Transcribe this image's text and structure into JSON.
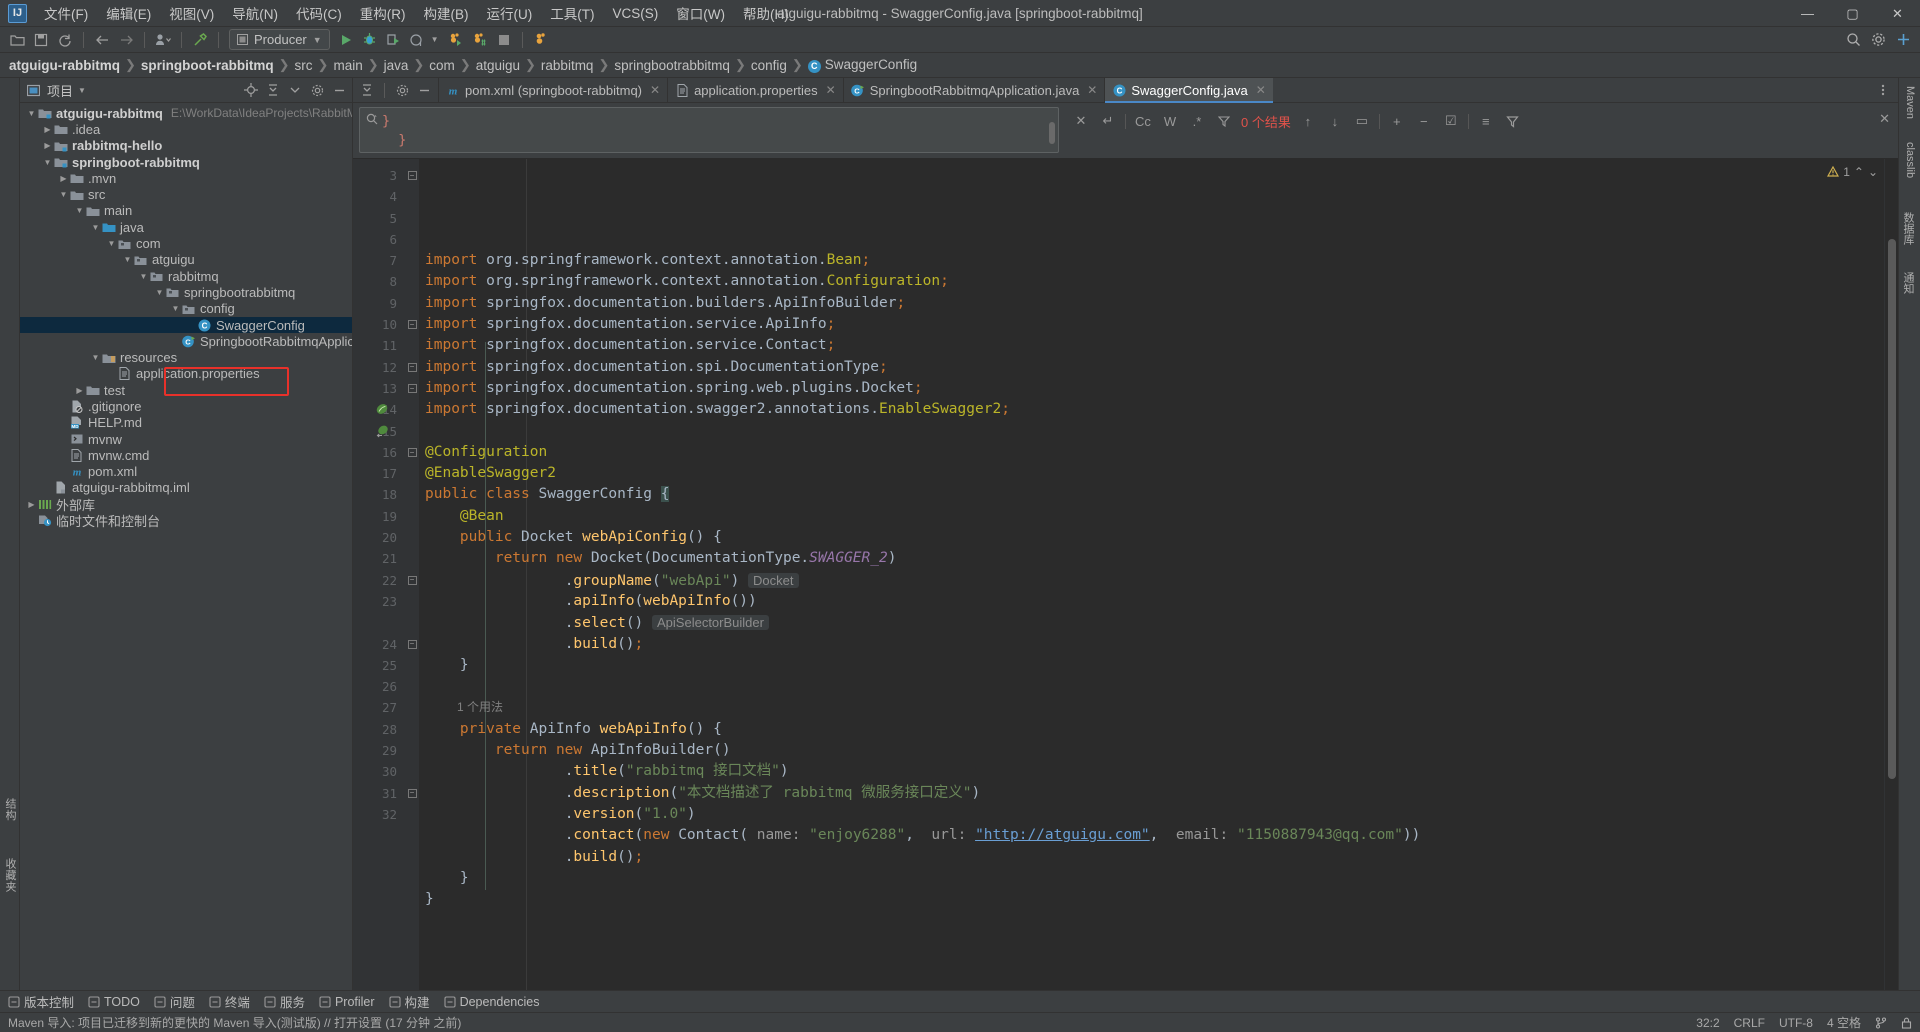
{
  "window": {
    "title": "atguigu-rabbitmq - SwaggerConfig.java [springboot-rabbitmq]",
    "logo": "IJ",
    "controls": {
      "minimize": "—",
      "maximize": "▢",
      "close": "✕"
    }
  },
  "menubar": [
    {
      "label": "文件(F)"
    },
    {
      "label": "编辑(E)"
    },
    {
      "label": "视图(V)"
    },
    {
      "label": "导航(N)"
    },
    {
      "label": "代码(C)"
    },
    {
      "label": "重构(R)"
    },
    {
      "label": "构建(B)"
    },
    {
      "label": "运行(U)"
    },
    {
      "label": "工具(T)"
    },
    {
      "label": "VCS(S)"
    },
    {
      "label": "窗口(W)"
    },
    {
      "label": "帮助(H)"
    }
  ],
  "toolbar": {
    "run_config": "Producer",
    "icons": [
      "open-folder-icon",
      "save-all-icon",
      "sync-icon",
      "back-icon",
      "forward-icon",
      "profile-icon",
      "build-icon",
      "run-icon",
      "debug-icon",
      "run-coverage-icon",
      "profiler-icon",
      "stop-icon"
    ],
    "right_icons": [
      "search-everywhere-icon",
      "settings-icon",
      "help-icon"
    ]
  },
  "breadcrumb": {
    "items": [
      {
        "label": "atguigu-rabbitmq",
        "bold": true
      },
      {
        "label": "springboot-rabbitmq",
        "bold": true
      },
      {
        "label": "src",
        "bold": false
      },
      {
        "label": "main",
        "bold": false
      },
      {
        "label": "java",
        "bold": false
      },
      {
        "label": "com",
        "bold": false
      },
      {
        "label": "atguigu",
        "bold": false
      },
      {
        "label": "rabbitmq",
        "bold": false
      },
      {
        "label": "springbootrabbitmq",
        "bold": false
      },
      {
        "label": "config",
        "bold": false
      },
      {
        "label": "SwaggerConfig",
        "bold": false,
        "icon": "class-icon"
      }
    ],
    "separator": "❯"
  },
  "project_panel": {
    "title": "项目",
    "title_icon": "project-icon",
    "header_icons": [
      "locate-icon",
      "collapse-all-icon",
      "options-icon",
      "settings-icon",
      "hide-icon"
    ],
    "tree": [
      {
        "depth": 0,
        "arrow": "down",
        "icon": "module-icon",
        "label": "atguigu-rabbitmq",
        "bold": true,
        "path": "E:\\WorkData\\IdeaProjects\\RabbitMQ\\at"
      },
      {
        "depth": 1,
        "arrow": "right",
        "icon": "folder-icon",
        "label": ".idea",
        "bold": false
      },
      {
        "depth": 1,
        "arrow": "right",
        "icon": "module-icon",
        "label": "rabbitmq-hello",
        "bold": true
      },
      {
        "depth": 1,
        "arrow": "down",
        "icon": "module-icon",
        "label": "springboot-rabbitmq",
        "bold": true
      },
      {
        "depth": 2,
        "arrow": "right",
        "icon": "folder-icon",
        "label": ".mvn",
        "bold": false
      },
      {
        "depth": 2,
        "arrow": "down",
        "icon": "folder-icon",
        "label": "src",
        "bold": false
      },
      {
        "depth": 3,
        "arrow": "down",
        "icon": "folder-icon",
        "label": "main",
        "bold": false
      },
      {
        "depth": 4,
        "arrow": "down",
        "icon": "source-folder-icon",
        "label": "java",
        "bold": false
      },
      {
        "depth": 5,
        "arrow": "down",
        "icon": "package-icon",
        "label": "com",
        "bold": false
      },
      {
        "depth": 6,
        "arrow": "down",
        "icon": "package-icon",
        "label": "atguigu",
        "bold": false
      },
      {
        "depth": 7,
        "arrow": "down",
        "icon": "package-icon",
        "label": "rabbitmq",
        "bold": false
      },
      {
        "depth": 8,
        "arrow": "down",
        "icon": "package-icon",
        "label": "springbootrabbitmq",
        "bold": false
      },
      {
        "depth": 9,
        "arrow": "down",
        "icon": "package-icon",
        "label": "config",
        "bold": false
      },
      {
        "depth": 10,
        "arrow": "none",
        "icon": "class-icon",
        "label": "SwaggerConfig",
        "bold": false,
        "selected": true
      },
      {
        "depth": 9,
        "arrow": "none",
        "icon": "spring-class-icon",
        "label": "SpringbootRabbitmqApplication",
        "bold": false
      },
      {
        "depth": 4,
        "arrow": "down",
        "icon": "resource-folder-icon",
        "label": "resources",
        "bold": false
      },
      {
        "depth": 5,
        "arrow": "none",
        "icon": "properties-icon",
        "label": "application.properties",
        "bold": false
      },
      {
        "depth": 3,
        "arrow": "right",
        "icon": "folder-icon",
        "label": "test",
        "bold": false
      },
      {
        "depth": 2,
        "arrow": "none",
        "icon": "gitignore-icon",
        "label": ".gitignore",
        "bold": false
      },
      {
        "depth": 2,
        "arrow": "none",
        "icon": "markdown-icon",
        "label": "HELP.md",
        "bold": false
      },
      {
        "depth": 2,
        "arrow": "none",
        "icon": "shell-icon",
        "label": "mvnw",
        "bold": false
      },
      {
        "depth": 2,
        "arrow": "none",
        "icon": "cmd-icon",
        "label": "mvnw.cmd",
        "bold": false
      },
      {
        "depth": 2,
        "arrow": "none",
        "icon": "maven-icon",
        "label": "pom.xml",
        "bold": false
      },
      {
        "depth": 1,
        "arrow": "none",
        "icon": "iml-icon",
        "label": "atguigu-rabbitmq.iml",
        "bold": false
      },
      {
        "depth": 0,
        "arrow": "right",
        "icon": "library-icon",
        "label": "外部库",
        "bold": false
      },
      {
        "depth": 0,
        "arrow": "none",
        "icon": "scratches-icon",
        "label": "临时文件和控制台",
        "bold": false
      }
    ]
  },
  "editor_tabs": {
    "tool_icons": [
      "collapse-icon",
      "settings-icon",
      "minimize-icon"
    ],
    "tabs": [
      {
        "label": "pom.xml (springboot-rabbitmq)",
        "icon": "maven-icon",
        "active": false,
        "close": "✕"
      },
      {
        "label": "application.properties",
        "icon": "properties-icon",
        "active": false,
        "close": "✕"
      },
      {
        "label": "SpringbootRabbitmqApplication.java",
        "icon": "spring-class-icon",
        "active": false,
        "close": "✕"
      },
      {
        "label": "SwaggerConfig.java",
        "icon": "class-icon",
        "active": true,
        "close": "✕"
      }
    ]
  },
  "find_bar": {
    "search_icon": "search-icon",
    "query_line1": "}",
    "query_line2": "}",
    "close_x": "✕",
    "regex_reset": "↵",
    "match_case": "Cc",
    "words": "W",
    "regex": ".*",
    "filter_icon": "filter-icon",
    "result_count": "0 个结果",
    "prev": "↑",
    "next": "↓",
    "select_all": "▭",
    "add_icon": "+",
    "remove_icon": "−",
    "check_icon": "☑",
    "list_icon": "≡",
    "funnel_icon": "⧩",
    "panel_close": "✕"
  },
  "inspections": {
    "warning_count": "1",
    "warning_icon": "warning-triangle-icon",
    "up_icon": "⌃",
    "down_icon": "⌄"
  },
  "code": {
    "lines": [
      {
        "n": 3,
        "fold": "start",
        "html": "<span class='kw'>import</span> <span class='plain'>org.springframework.context.annotation.</span><span class='anno'>Bean</span><span class='semi'>;</span>"
      },
      {
        "n": 4,
        "fold": "none",
        "html": "<span class='kw'>import</span> <span class='plain'>org.springframework.context.annotation.</span><span class='anno'>Configuration</span><span class='semi'>;</span>"
      },
      {
        "n": 5,
        "fold": "none",
        "html": "<span class='kw'>import</span> <span class='plain'>springfox.documentation.builders.ApiInfoBuilder</span><span class='semi'>;</span>"
      },
      {
        "n": 6,
        "fold": "none",
        "html": "<span class='kw'>import</span> <span class='plain'>springfox.documentation.service.ApiInfo</span><span class='semi'>;</span>"
      },
      {
        "n": 7,
        "fold": "none",
        "html": "<span class='kw'>import</span> <span class='plain'>springfox.documentation.service.Contact</span><span class='semi'>;</span>"
      },
      {
        "n": 8,
        "fold": "none",
        "html": "<span class='kw'>import</span> <span class='plain'>springfox.documentation.spi.DocumentationType</span><span class='semi'>;</span>"
      },
      {
        "n": 9,
        "fold": "none",
        "html": "<span class='kw'>import</span> <span class='plain'>springfox.documentation.spring.web.plugins.Docket</span><span class='semi'>;</span>"
      },
      {
        "n": 10,
        "fold": "end",
        "html": "<span class='kw'>import</span> <span class='plain'>springfox.documentation.swagger2.annotations.</span><span class='anno'>EnableSwagger2</span><span class='semi'>;</span>"
      },
      {
        "n": 11,
        "fold": "none",
        "html": ""
      },
      {
        "n": 12,
        "fold": "start",
        "html": "<span class='anno'>@Configuration</span>"
      },
      {
        "n": 13,
        "fold": "end",
        "html": "<span class='anno'>@EnableSwagger2</span>"
      },
      {
        "n": 14,
        "fold": "none",
        "gmark": "bean-icon",
        "html": "<span class='kw'>public class</span> <span class='cls'>SwaggerConfig</span> <span class='brace-hl punct'>{</span>"
      },
      {
        "n": 15,
        "fold": "none",
        "gmark": "bean-method-icon",
        "html": "    <span class='anno'>@Bean</span>"
      },
      {
        "n": 16,
        "fold": "start",
        "html": "    <span class='kw'>public</span> <span class='cls'>Docket</span> <span class='yel'>webApiConfig</span><span class='punct'>() {</span>"
      },
      {
        "n": 17,
        "fold": "none",
        "html": "        <span class='kw'>return new</span> <span class='cls'>Docket</span><span class='punct'>(</span><span class='cls'>DocumentationType.</span><span class='stat'>SWAGGER_2</span><span class='punct'>)</span>"
      },
      {
        "n": 18,
        "fold": "none",
        "html": "                <span class='punct'>.</span><span class='yel'>groupName</span><span class='punct'>(</span><span class='str'>\"webApi\"</span><span class='punct'>)</span> <span class='inlay'>Docket</span>"
      },
      {
        "n": 19,
        "fold": "none",
        "html": "                <span class='punct'>.</span><span class='yel'>apiInfo</span><span class='punct'>(</span><span class='yel'>webApiInfo</span><span class='punct'>())</span>"
      },
      {
        "n": 20,
        "fold": "none",
        "html": "                <span class='punct'>.</span><span class='yel'>select</span><span class='punct'>()</span> <span class='inlay'>ApiSelectorBuilder</span>"
      },
      {
        "n": 21,
        "fold": "none",
        "html": "                <span class='punct'>.</span><span class='yel'>build</span><span class='punct'>()</span><span class='semi'>;</span>"
      },
      {
        "n": 22,
        "fold": "end",
        "html": "    <span class='punct'>}</span>"
      },
      {
        "n": 23,
        "fold": "none",
        "html": ""
      },
      {
        "n": -1,
        "fold": "none",
        "hint": "1 个用法"
      },
      {
        "n": 24,
        "fold": "start",
        "html": "    <span class='kw'>private</span> <span class='cls'>ApiInfo</span> <span class='yel'>webApiInfo</span><span class='punct'>() {</span>"
      },
      {
        "n": 25,
        "fold": "none",
        "html": "        <span class='kw'>return new</span> <span class='cls'>ApiInfoBuilder</span><span class='punct'>()</span>"
      },
      {
        "n": 26,
        "fold": "none",
        "html": "                <span class='punct'>.</span><span class='yel'>title</span><span class='punct'>(</span><span class='str'>\"rabbitmq 接口文档\"</span><span class='punct'>)</span>"
      },
      {
        "n": 27,
        "fold": "none",
        "html": "                <span class='punct'>.</span><span class='yel'>description</span><span class='punct'>(</span><span class='str'>\"本文档描述了 rabbitmq 微服务接口定义\"</span><span class='punct'>)</span>"
      },
      {
        "n": 28,
        "fold": "none",
        "html": "                <span class='punct'>.</span><span class='yel'>version</span><span class='punct'>(</span><span class='str'>\"1.0\"</span><span class='punct'>)</span>"
      },
      {
        "n": 29,
        "fold": "none",
        "html": "                <span class='punct'>.</span><span class='yel'>contact</span><span class='punct'>(</span><span class='kw'>new</span> <span class='cls'>Contact</span><span class='punct'>(</span> <span class='param-hint'>name:</span> <span class='str'>\"enjoy6288\"</span><span class='punct'>,</span>  <span class='param-hint'>url:</span> <span class='str link'>\"http://atguigu.com\"</span><span class='punct'>,</span>  <span class='param-hint'>email:</span> <span class='str'>\"1150887943@qq.com\"</span><span class='punct'>))</span>"
      },
      {
        "n": 30,
        "fold": "none",
        "html": "                <span class='punct'>.</span><span class='yel'>build</span><span class='punct'>()</span><span class='semi'>;</span>"
      },
      {
        "n": 31,
        "fold": "end",
        "html": "    <span class='punct'>}</span>"
      },
      {
        "n": 32,
        "fold": "none",
        "html": "<span class='punct'>}</span>"
      }
    ]
  },
  "left_strip": {
    "tabs": [
      {
        "label": "结构"
      },
      {
        "label": "收藏夹"
      }
    ]
  },
  "right_strip": {
    "tabs": [
      {
        "label": "Maven"
      },
      {
        "label": "classlib"
      },
      {
        "label": "数据库"
      },
      {
        "label": "通知"
      }
    ]
  },
  "bottom_bar": {
    "items": [
      {
        "label": "版本控制",
        "icon": "vcs-icon"
      },
      {
        "label": "TODO",
        "icon": "todo-icon"
      },
      {
        "label": "问题",
        "icon": "problems-icon"
      },
      {
        "label": "终端",
        "icon": "terminal-icon"
      },
      {
        "label": "服务",
        "icon": "services-icon"
      },
      {
        "label": "Profiler",
        "icon": "profiler-icon"
      },
      {
        "label": "构建",
        "icon": "build-icon"
      },
      {
        "label": "Dependencies",
        "icon": "dependencies-icon"
      }
    ]
  },
  "status_bar": {
    "message": "Maven 导入: 项目已迁移到新的更快的 Maven 导入(测试版) // 打开设置 (17 分钟 之前)",
    "caret": "32:2",
    "line_sep": "CRLF",
    "encoding": "UTF-8",
    "indent": "4 空格",
    "branch_icon": "branch-icon",
    "lock_icon": "lock-icon"
  }
}
